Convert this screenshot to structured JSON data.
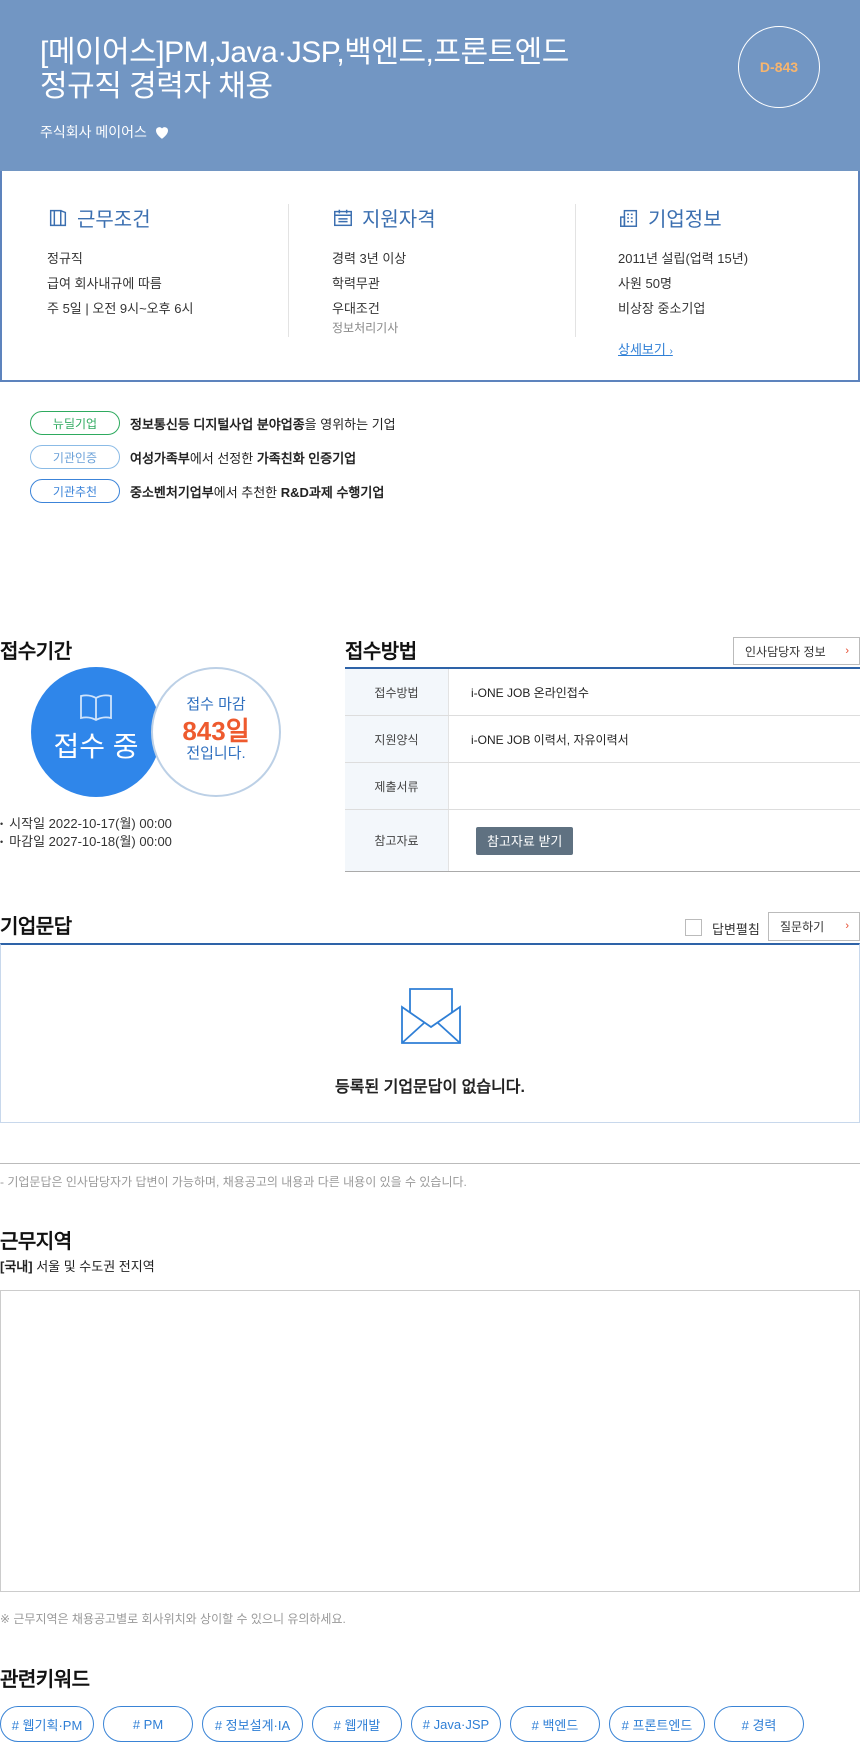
{
  "header": {
    "title_line1": "[메이어스]PM,Java·JSP,백엔드,프론트엔드",
    "title_line2": "정규직 경력자 채용",
    "company": "주식회사 메이어스",
    "dday": "D-843"
  },
  "summary": {
    "work": {
      "title": "근무조건",
      "lines": [
        "정규직",
        "급여 회사내규에 따름",
        "주 5일 | 오전 9시~오후 6시"
      ]
    },
    "qualification": {
      "title": "지원자격",
      "lines": [
        "경력 3년 이상",
        "학력무관",
        "우대조건"
      ],
      "sub": "정보처리기사"
    },
    "company": {
      "title": "기업정보",
      "lines": [
        "2011년 설립(업력 15년)",
        "사원 50명",
        "비상장 중소기업"
      ],
      "more": "상세보기"
    }
  },
  "badges": [
    {
      "label": "뉴딜기업",
      "text_b1": "정보통신등 디지털사업 분야업종",
      "text_r1": "을 영위하는 기업",
      "text_b2": "",
      "text_r2": ""
    },
    {
      "label": "기관인증",
      "text_b1": "여성가족부",
      "text_r1": "에서 선정한 ",
      "text_b2": "가족친화 인증기업",
      "text_r2": ""
    },
    {
      "label": "기관추천",
      "text_b1": "중소벤처기업부",
      "text_r1": "에서 추천한 ",
      "text_b2": "R&D과제 수행기업",
      "text_r2": ""
    }
  ],
  "reception": {
    "title": "접수기간",
    "status": "접수 중",
    "deadline_label": "접수 마감",
    "days": "843일",
    "days_suffix": "전입니다.",
    "start": "시작일 2022-10-17(월) 00:00",
    "end": "마감일 2027-10-18(월) 00:00"
  },
  "method": {
    "title": "접수방법",
    "hr_button": "인사담당자 정보",
    "rows": [
      {
        "th": "접수방법",
        "td": "i-ONE JOB 온라인접수"
      },
      {
        "th": "지원양식",
        "td": "i-ONE JOB 이력서, 자유이력서"
      },
      {
        "th": "제출서류",
        "td": ""
      },
      {
        "th": "참고자료",
        "button": "참고자료 받기"
      }
    ]
  },
  "qna": {
    "title": "기업문답",
    "checkbox_label": "답변펼침",
    "ask_button": "질문하기",
    "empty": "등록된 기업문답이 없습니다.",
    "note": "- 기업문답은 인사담당자가 답변이 가능하며, 채용공고의 내용과 다른 내용이 있을 수 있습니다."
  },
  "location": {
    "title": "근무지역",
    "tag": "[국내]",
    "text": " 서울 및 수도권 전지역",
    "note": "※ 근무지역은 채용공고별로 회사위치와 상이할 수 있으니 유의하세요."
  },
  "keywords": {
    "title": "관련키워드",
    "items": [
      "# 웹기획·PM",
      "# PM",
      "# 정보설계·IA",
      "# 웹개발",
      "# Java·JSP",
      "# 백엔드",
      "# 프론트엔드",
      "# 경력"
    ]
  },
  "colors": {
    "hero": "#7296c3",
    "accent": "#2f86ea",
    "dday": "#f7b56e",
    "days": "#ee5a2e"
  }
}
